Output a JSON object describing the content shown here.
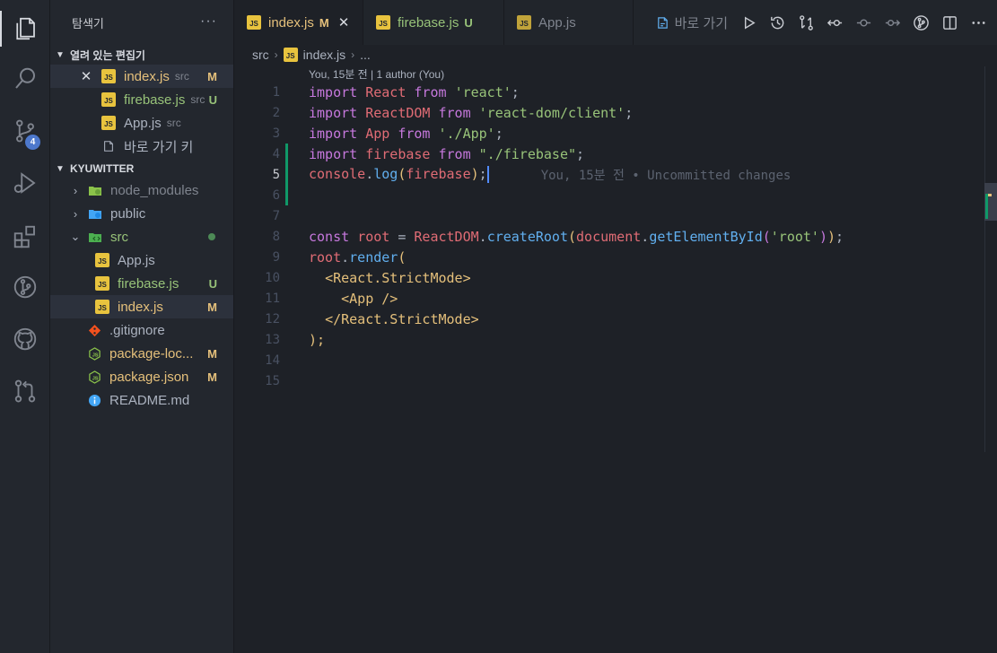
{
  "activity": {
    "icons": [
      "explorer-icon",
      "search-icon",
      "source-control-icon",
      "run-debug-icon",
      "extensions-icon",
      "git-graph-icon",
      "github-icon",
      "pull-request-icon"
    ],
    "scm_badge": "4"
  },
  "sidebar": {
    "title": "탐색기",
    "more": "···",
    "open_editors_title": "열려 있는 편집기",
    "open_editors": [
      {
        "name": "index.js",
        "hint": "src",
        "status": "M"
      },
      {
        "name": "firebase.js",
        "hint": "src",
        "status": "U"
      },
      {
        "name": "App.js",
        "hint": "src",
        "status": ""
      },
      {
        "name": "바로 가기 키",
        "hint": "",
        "status": ""
      }
    ],
    "workspace_title": "KYUWITTER",
    "tree": [
      {
        "name": "node_modules",
        "status": ""
      },
      {
        "name": "public",
        "status": ""
      },
      {
        "name": "src",
        "status": "dot"
      },
      {
        "name": "App.js",
        "status": ""
      },
      {
        "name": "firebase.js",
        "status": "U"
      },
      {
        "name": "index.js",
        "status": "M"
      },
      {
        "name": ".gitignore",
        "status": ""
      },
      {
        "name": "package-loc...",
        "status": "M"
      },
      {
        "name": "package.json",
        "status": "M"
      },
      {
        "name": "README.md",
        "status": ""
      }
    ]
  },
  "tabs": [
    {
      "name": "index.js",
      "status": "M",
      "close": "✕"
    },
    {
      "name": "firebase.js",
      "status": "U"
    },
    {
      "name": "App.js",
      "status": ""
    }
  ],
  "toolbar": {
    "goto_label": "바로 가기"
  },
  "breadcrumb": {
    "folder": "src",
    "file": "index.js",
    "rest": "..."
  },
  "blame": {
    "header": "You, 15분 전 | 1 author (You)",
    "inline": "You, 15분 전 • Uncommitted changes"
  },
  "code": {
    "line_numbers": [
      "1",
      "2",
      "3",
      "4",
      "5",
      "6",
      "7",
      "8",
      "9",
      "10",
      "11",
      "12",
      "13",
      "14",
      "15"
    ],
    "tokens": {
      "import": "import",
      "from": "from",
      "const": "const",
      "react_id": "React",
      "react_str": "'react'",
      "reactdom_id": "ReactDOM",
      "reactdom_str": "'react-dom/client'",
      "app_id": "App",
      "app_str": "'./App'",
      "firebase_id": "firebase",
      "firebase_str": "\"./firebase\"",
      "console": "console",
      "log": "log",
      "root": "root",
      "createRoot": "createRoot",
      "document": "document",
      "getElementById": "getElementById",
      "root_str": "'root'",
      "render": "render",
      "strict_open": "<React.StrictMode>",
      "app_tag": "<App />",
      "strict_close": "</React.StrictMode>",
      "close_paren": ");"
    }
  }
}
